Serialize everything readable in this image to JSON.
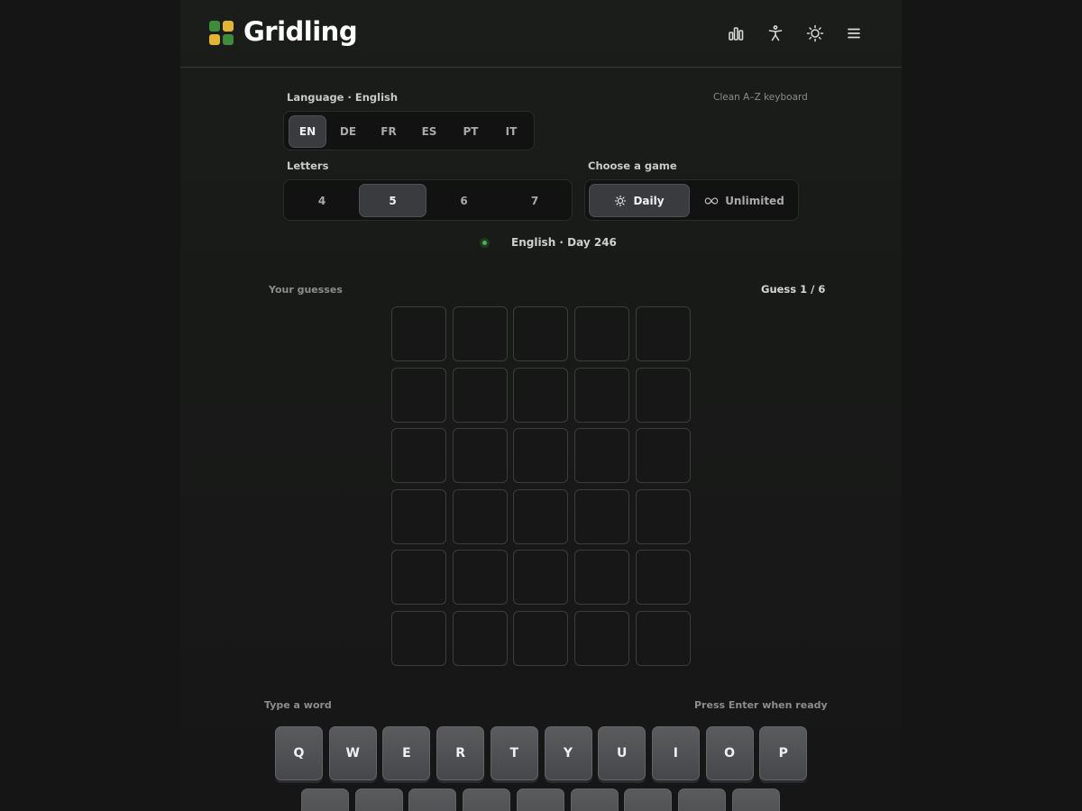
{
  "header": {
    "brand": "Gridling",
    "icons": [
      "stats-icon",
      "accessibility-icon",
      "theme-icon",
      "menu-icon"
    ]
  },
  "language": {
    "label": "Language · English",
    "note": "Clean A–Z keyboard",
    "options": [
      "EN",
      "DE",
      "FR",
      "ES",
      "PT",
      "IT"
    ],
    "selected": "EN"
  },
  "letters": {
    "label": "Letters",
    "options": [
      "4",
      "5",
      "6",
      "7"
    ],
    "selected": "5"
  },
  "game": {
    "label": "Choose a game",
    "daily": "Daily",
    "unlimited": "Unlimited",
    "selected": "Daily"
  },
  "status": {
    "text": "English · Day 246",
    "color": "#4caf50"
  },
  "board": {
    "label": "Your guesses",
    "counter": "Guess 1 / 6",
    "rows": 6,
    "cols": 5
  },
  "keyboard": {
    "left_hint": "Type a word",
    "right_hint": "Press Enter when ready",
    "row1": [
      "Q",
      "W",
      "E",
      "R",
      "T",
      "Y",
      "U",
      "I",
      "O",
      "P"
    ]
  },
  "colors": {
    "green": "#3f8a3b",
    "yellow": "#e3b534",
    "background": "#151515"
  }
}
